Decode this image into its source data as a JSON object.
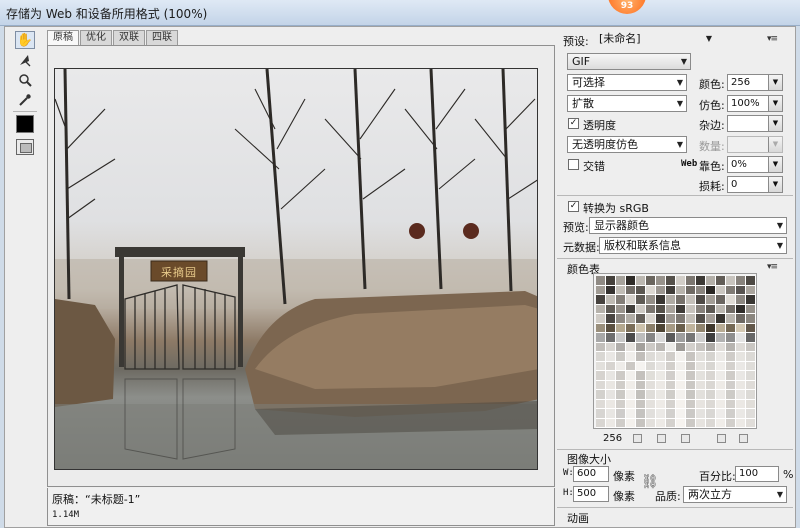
{
  "window": {
    "title": "存储为 Web 和设备所用格式 (100%)",
    "badge": "93"
  },
  "tools": [
    {
      "name": "hand-tool-icon"
    },
    {
      "name": "slice-select-tool-icon"
    },
    {
      "name": "zoom-tool-icon"
    },
    {
      "name": "eyedropper-tool-icon"
    }
  ],
  "tabs": [
    "原稿",
    "优化",
    "双联",
    "四联"
  ],
  "preview": {
    "sign_text": "采摘园",
    "info_line1": "原稿：“未标题-1”",
    "info_line2": "1.14M"
  },
  "settings": {
    "preset_label": "预设:",
    "preset_value": "[未命名]",
    "format_value": "GIF",
    "reduction_value": "可选择",
    "colors_label": "颜色:",
    "colors_value": "256",
    "dither_algo_value": "扩散",
    "dither_label": "仿色:",
    "dither_value": "100%",
    "transparency_label": "透明度",
    "transparency_checked": true,
    "matte_label": "杂边:",
    "matte_value": "",
    "transparency_dither_value": "无透明度仿色",
    "amount_label": "数量:",
    "amount_value": "",
    "interlaced_label": "交错",
    "interlaced_checked": false,
    "web_snap_prefix": "Web",
    "web_snap_label": "靠色:",
    "web_snap_value": "0%",
    "lossy_label": "损耗:",
    "lossy_value": "0",
    "convert_srgb_label": "转换为 sRGB",
    "convert_srgb_checked": true,
    "preview_label": "预览:",
    "preview_value": "显示器颜色",
    "metadata_label": "元数据:",
    "metadata_value": "版权和联系信息"
  },
  "color_table": {
    "title": "颜色表",
    "count": "256",
    "colors": [
      "#8f8a84",
      "#45413c",
      "#a6a29b",
      "#2f2c28",
      "#bcb8b1",
      "#6b665f",
      "#98938c",
      "#55514b",
      "#d2cec8",
      "#7c7771",
      "#3c3935",
      "#b3afa8",
      "#625d57",
      "#c8c4be",
      "#88837d",
      "#4d4944",
      "#a19c95",
      "#353230",
      "#c1bdb6",
      "#726d67",
      "#5b5751",
      "#dcd8d2",
      "#9c9791",
      "#413e3a",
      "#b8b4ad",
      "#6f6a64",
      "#8a857f",
      "#2a2724",
      "#cbc7c1",
      "#7f7a74",
      "#575350",
      "#aaa59e",
      "#47433f",
      "#bfbbb4",
      "#837e78",
      "#d6d2cc",
      "#5f5b55",
      "#948f88",
      "#3a3733",
      "#afaba4",
      "#76716b",
      "#c4c0ba",
      "#4f4b47",
      "#a39e97",
      "#6a6560",
      "#dfdbd5",
      "#8c8781",
      "#393633",
      "#b6b2ab",
      "#605c56",
      "#9a958e",
      "#43403c",
      "#cecac4",
      "#7a756f",
      "#545049",
      "#a8a39c",
      "#3f3c38",
      "#c7c3bd",
      "#86817b",
      "#5d5953",
      "#bbb7b0",
      "#716c66",
      "#302d2a",
      "#959089",
      "#d0ccc6",
      "#4a4642",
      "#8e8983",
      "#b1ada6",
      "#65605a",
      "#dad6d0",
      "#413d39",
      "#9e9993",
      "#7d7872",
      "#c3bfb8",
      "#524e49",
      "#a59f98",
      "#37342f",
      "#b9b5ae",
      "#6d6862",
      "#8b867f",
      "#9a8f7c",
      "#5b5040",
      "#b4a88f",
      "#7a6d58",
      "#cdc2ac",
      "#8a7e69",
      "#4d4434",
      "#a69a84",
      "#6a5f4c",
      "#c0b49d",
      "#91856f",
      "#3f372b",
      "#b9ad96",
      "#756955",
      "#d4c9b4",
      "#62574a",
      "#a8a8a8",
      "#6e6e6e",
      "#c9c9c9",
      "#4b4b4b",
      "#bdbdbd",
      "#858585",
      "#dadada",
      "#5a5a5a",
      "#9f9f9f",
      "#767676",
      "#cfcfcf",
      "#3e3e3e",
      "#b2b2b2",
      "#8e8e8e",
      "#e4e4e4",
      "#666666",
      "#c2bfbb",
      "#d8d5d1",
      "#b0adaa",
      "#e6e3df",
      "#a3a09c",
      "#cdcac6",
      "#bab7b3",
      "#ecebe8",
      "#9d9a96",
      "#d3d0cc",
      "#c6c3bf",
      "#aeaba7",
      "#e0ddd9",
      "#b7b4b0",
      "#dedbd7",
      "#c9c6c2",
      "#d9d7d3",
      "#e9e7e4",
      "#cccac6",
      "#f0eeeb",
      "#c1beba",
      "#dddbd7",
      "#e4e2de",
      "#d0cdc9",
      "#f3f1ee",
      "#c7c4c0",
      "#e1dfdb",
      "#d5d3cf",
      "#ebe9e6",
      "#cfccc8",
      "#e6e4e0",
      "#dbd9d5",
      "#e2e0dc",
      "#d7d4d0",
      "#eeece9",
      "#cbc8c4",
      "#f5f3f0",
      "#dcdad6",
      "#e8e6e3",
      "#d2cfcb",
      "#f1efec",
      "#c8c5c1",
      "#e5e3df",
      "#d8d6d2",
      "#efedea",
      "#d4d1cd",
      "#eae8e5",
      "#dfddd9",
      "#d6d3cf",
      "#e7e5e2",
      "#cdcac6",
      "#f2f0ed",
      "#c4c1bd",
      "#e0ded9",
      "#ebe9e5",
      "#d1cecb",
      "#f4f2ef",
      "#cac7c3",
      "#e3e1dd",
      "#d9d6d2",
      "#edebe8",
      "#cfccc8",
      "#e9e7e4",
      "#dddbd7",
      "#dcd9d5",
      "#e9e6e2",
      "#d0cdc9",
      "#f0ede9",
      "#c6c3bf",
      "#e2dfdb",
      "#ecE9e5",
      "#d3d0cc",
      "#f4f1ed",
      "#cbc8c4",
      "#e5e2de",
      "#dad7d3",
      "#eeebe7",
      "#d1cecb",
      "#eae7e3",
      "#dfdcd8",
      "#d3d1cd",
      "#e6e4e1",
      "#cbc9c5",
      "#f1efec",
      "#c2c0bc",
      "#dfddd9",
      "#eae8e4",
      "#cfcdc9",
      "#f3f1ee",
      "#c8c6c2",
      "#e2e0dc",
      "#d7d5d1",
      "#ecEaE7",
      "#cdcbc7",
      "#e8e6e3",
      "#dcdad6",
      "#dedbd7",
      "#ebe8e4",
      "#d2cfcb",
      "#f2efeb",
      "#c8c5c1",
      "#e4e1dd",
      "#eeebe7",
      "#d5d2ce",
      "#f5f2ee",
      "#cdcac6",
      "#e7e4e0",
      "#dcd9d5",
      "#efece8",
      "#d3d0cc",
      "#ebe8e4",
      "#e1ded9",
      "#d7d5d2",
      "#e8e6e3",
      "#cecccA",
      "#f3f1ee",
      "#c5c3c0",
      "#e1dfdc",
      "#ebe9e6",
      "#d2d0cd",
      "#f5f3f0",
      "#cbc9c6",
      "#e4e2df",
      "#d9d7d4",
      "#eeeceA",
      "#d0cecb",
      "#eae8e5",
      "#dfdddA",
      "#d9d6d2",
      "#ece9e5",
      "#d0cdc9",
      "#f4f1ed",
      "#c7c4c0",
      "#e3e0dc",
      "#edeae6",
      "#d4d1cd",
      "#f6f3ef",
      "#ccc9c5",
      "#e6e3df",
      "#dbd8d4",
      "#f0ede9",
      "#d2cfcb",
      "#ece9e5",
      "#e0ddd9"
    ]
  },
  "image_size": {
    "title": "图像大小",
    "w_label": "W:",
    "w_value": "600",
    "h_label": "H:",
    "h_value": "500",
    "unit": "像素",
    "percent_label": "百分比:",
    "percent_value": "100",
    "percent_unit": "%",
    "quality_label": "品质:",
    "quality_value": "两次立方"
  },
  "animation": {
    "title": "动画"
  }
}
